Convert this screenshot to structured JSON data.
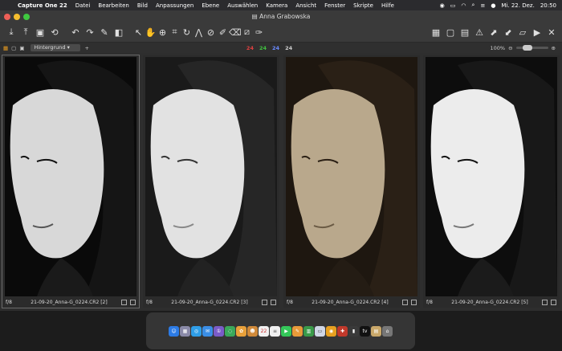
{
  "menubar": {
    "app": "Capture One 22",
    "items": [
      "Datei",
      "Bearbeiten",
      "Bild",
      "Anpassungen",
      "Ebene",
      "Auswählen",
      "Kamera",
      "Ansicht",
      "Fenster",
      "Skripte",
      "Hilfe"
    ],
    "date": "Mi. 22. Dez.",
    "time": "20:50"
  },
  "window": {
    "title": "Anna Grabowska"
  },
  "viewbar": {
    "layer": "Hintergrund",
    "counts": {
      "red": "24",
      "green": "24",
      "blue": "24",
      "white": "24"
    },
    "zoom": "100%"
  },
  "variants": [
    {
      "aperture": "f/8",
      "filename": "21-09-20_Anna-G_0224.CR2 [2]"
    },
    {
      "aperture": "f/8",
      "filename": "21-09-20_Anna-G_0224.CR2 [3]"
    },
    {
      "aperture": "f/8",
      "filename": "21-09-20_Anna-G_0224.CR2 [4]"
    },
    {
      "aperture": "f/8",
      "filename": "21-09-20_Anna-G_0224.CR2 [5]"
    }
  ],
  "dock": {
    "calendar_day": "22"
  },
  "colors": {
    "accent": "#f0a020",
    "red": "#e04040",
    "green": "#40c040",
    "blue": "#6a8aff"
  }
}
